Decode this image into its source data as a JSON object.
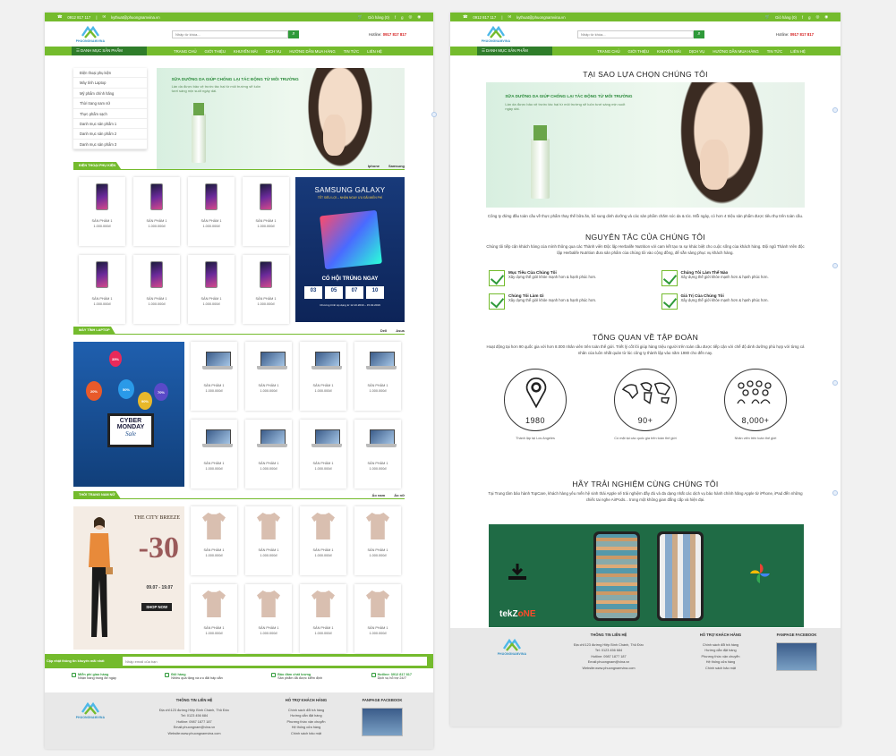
{
  "topbar": {
    "phone": "0912 817 117",
    "email": "kythuat@phuongnamvina.vn",
    "cart": "Giỏ hàng (0)"
  },
  "logo": {
    "name": "PHUONGNAMVINA"
  },
  "search": {
    "placeholder": "Nhập từ khóa..."
  },
  "hotline": {
    "label": "Hotline:",
    "number": "0917 817 817"
  },
  "nav": {
    "category_button": "DANH MỤC SẢN PHẨM",
    "items": [
      "TRANG CHỦ",
      "GIỚI THIỆU",
      "KHUYẾN MÃI",
      "DỊCH VỤ",
      "HƯỚNG DẪN MUA HÀNG",
      "TIN TỨC",
      "LIÊN HỆ"
    ]
  },
  "categories": [
    "Điện thoại phụ kiện",
    "Máy tính Laptop",
    "Mỹ phẩm chính hãng",
    "Thời trang nam nữ",
    "Thực phẩm sạch",
    "Danh mục sản phẩm 1",
    "Danh mục sản phẩm 2",
    "Danh mục sản phẩm 3"
  ],
  "banner": {
    "title": "SỮA DƯỠNG DA GIÚP CHỐNG LẠI TÁC ĐỘNG TỪ MÔI TRƯỜNG",
    "subtitle": "Làn da được bảo vệ trước tác hại từ môi trường sẽ luôn tươi sáng mịn suốt ngày dài."
  },
  "sections": [
    {
      "title": "ĐIỆN THOẠI PHỤ KIỆN",
      "tabs": [
        "Iphone",
        "Samsung"
      ]
    },
    {
      "title": "MÁY TÍNH LAPTOP",
      "tabs": [
        "Dell",
        "Asus"
      ]
    },
    {
      "title": "THỜI TRANG NAM NỮ",
      "tabs": [
        "Áo nam",
        "Áo nữ"
      ]
    }
  ],
  "product": {
    "name": "SẢN PHẨM 1",
    "price": "1.000.000đ"
  },
  "promo_samsung": {
    "title": "SAMSUNG GALAXY",
    "tagline": "TẾT SIÊU LỢI – NHẬN NGAY ƯU ĐÃI MIỄN PHÍ",
    "big": "CÓ HỘI TRÚNG NGAY",
    "countdown": [
      "03",
      "05",
      "07",
      "10"
    ],
    "note": "Chương trình áp dụng từ 12.10.2019 – 15.02.2019"
  },
  "promo_cyber": {
    "balloons": [
      "20%",
      "50%",
      "70%",
      "90%",
      "35%"
    ],
    "line1": "CYBER MONDAY",
    "line2": "Sale"
  },
  "promo_fashion": {
    "title": "THE CITY BREEZE",
    "discount": "-30",
    "dates": "09.07 - 19.07",
    "cta": "SHOP NOW"
  },
  "newsletter": {
    "text": "Cập nhật thông tin khuyến mãi nhất",
    "placeholder": "Nhập email của bạn"
  },
  "features": [
    {
      "title": "Miễn phí giao hàng",
      "desc": "Nhận hàng trong 8e ngày"
    },
    {
      "title": "Đổi hàng",
      "desc": "Nhiều quà tặng và ưu đãi hấp dẫn"
    },
    {
      "title": "Bảo đảm chất lượng",
      "desc": "Sản phẩm đã được kiểm định"
    },
    {
      "title": "Hotline: 0912 817 817",
      "desc": "Dịch vụ hỗ trợ 24/7"
    }
  ],
  "footer": {
    "contact_title": "THÔNG TIN LIÊN HỆ",
    "contact_lines": [
      "Địa chỉ:123 đường Hiệp Bình Chánh, Thủ Đức",
      "Tel: 0123 456 684",
      "Hotline: 0987 1877 187",
      "Email:phuongnam@vina.vn",
      "Website:www.phuongnamvina.com"
    ],
    "contact_lines_right": [
      "Địa chỉ:123 đường Hiệp Bình Chánh, Thủ Đức",
      "Tel: 0123 456 684",
      "Hotline: 0987 1877 187",
      "Email:phuongnam@vina.vn",
      "Website:www.phuongnamvina.com"
    ],
    "support_title": "HỖ TRỢ KHÁCH HÀNG",
    "support_lines": [
      "Chính sách đổi trả hàng",
      "Hướng dẫn đặt hàng",
      "Phương thức vận chuyển",
      "Hệ thống cửa hàng",
      "Chính sách bảo mật"
    ],
    "fanpage_title": "FANPAGE FACEBOOK"
  },
  "why": {
    "title": "TẠI SAO LỰA CHỌN CHÚNG TÔI",
    "text": "Công ty đứng đầu toàn cầu về thực phẩm thay thế bữa ăn, bổ sung dinh dưỡng và các sản phẩm chăm sóc da & tóc. Mỗi ngày, có hơn 4 triệu sản phẩm được tiêu thụ trên toàn cầu."
  },
  "principles": {
    "title": "NGUYÊN TẮC CỦA CHÚNG TÔI",
    "text": "Chúng tôi tiếp cận khách hàng của mình thông qua các Thành viên Độc lập Herbalife Nutrition với cam kết tạo ra sự khác biệt cho cuộc sống của khách hàng. Đội ngũ Thành Viên độc lập Herbalife Nutrition đưa sản phẩm của chúng tôi vào cộng đồng, để sẵn sàng phục vụ khách hàng.",
    "items": [
      {
        "title": "Mục Tiêu Của Chúng Tôi",
        "desc": "Xây dựng thế giới khỏe mạnh hơn & hạnh phúc hơn."
      },
      {
        "title": "Chúng Tôi Làm Thế Nào",
        "desc": "Xây dựng thế giới khỏe mạnh hơn & hạnh phúc hơn."
      },
      {
        "title": "Chúng Tôi Làm Gì",
        "desc": "Xây dựng thế giới khỏe mạnh hơn & hạnh phúc hơn."
      },
      {
        "title": "Giá Trị Của Chúng Tôi",
        "desc": "Xây dựng thế giới khỏe mạnh hơn & hạnh phúc hơn."
      }
    ]
  },
  "overview": {
    "title": "TỔNG QUAN VỀ TẬP ĐOÀN",
    "text": "Hoạt động tại hơn 90 quốc gia với hơn 8.000 nhân viên trên toàn thế giới. Triết lý cốt lõi giúp hàng triệu người trên toàn cầu được tiếp cận với chế độ dinh dưỡng phù hợp với từng cá nhân của luôn nhất quán từ lúc công ty thành lập vào năm 1980 cho đến nay.",
    "stats": [
      {
        "value": "1980",
        "label": "Thành lập tại Los Angeles"
      },
      {
        "value": "90+",
        "label": "Có mặt tại các quốc gia trên toàn thế giới"
      },
      {
        "value": "8,000+",
        "label": "Nhân viên trên toàn thế giới"
      }
    ]
  },
  "experience": {
    "title": "HÃY TRẢI NGHIỆM CÙNG CHÚNG TÔI",
    "text": "Tại Trung tâm bảo hành TopCare, khách hàng yêu mến hệ sinh thái Apple sẽ trải nghiệm đầy đủ và đa dạng nhất các dịch vụ bảo hành chính hãng Apple từ iPhone, iPad đến những chiếc tai nghe AirPods... trong một không gian đẳng cấp và hiện đại.",
    "video_brand_a": "tekZ",
    "video_brand_b": "oNE"
  },
  "colors": {
    "green": "#74bb2d",
    "dark_green": "#2f7d2a",
    "hotline_red": "#d31b1b"
  }
}
